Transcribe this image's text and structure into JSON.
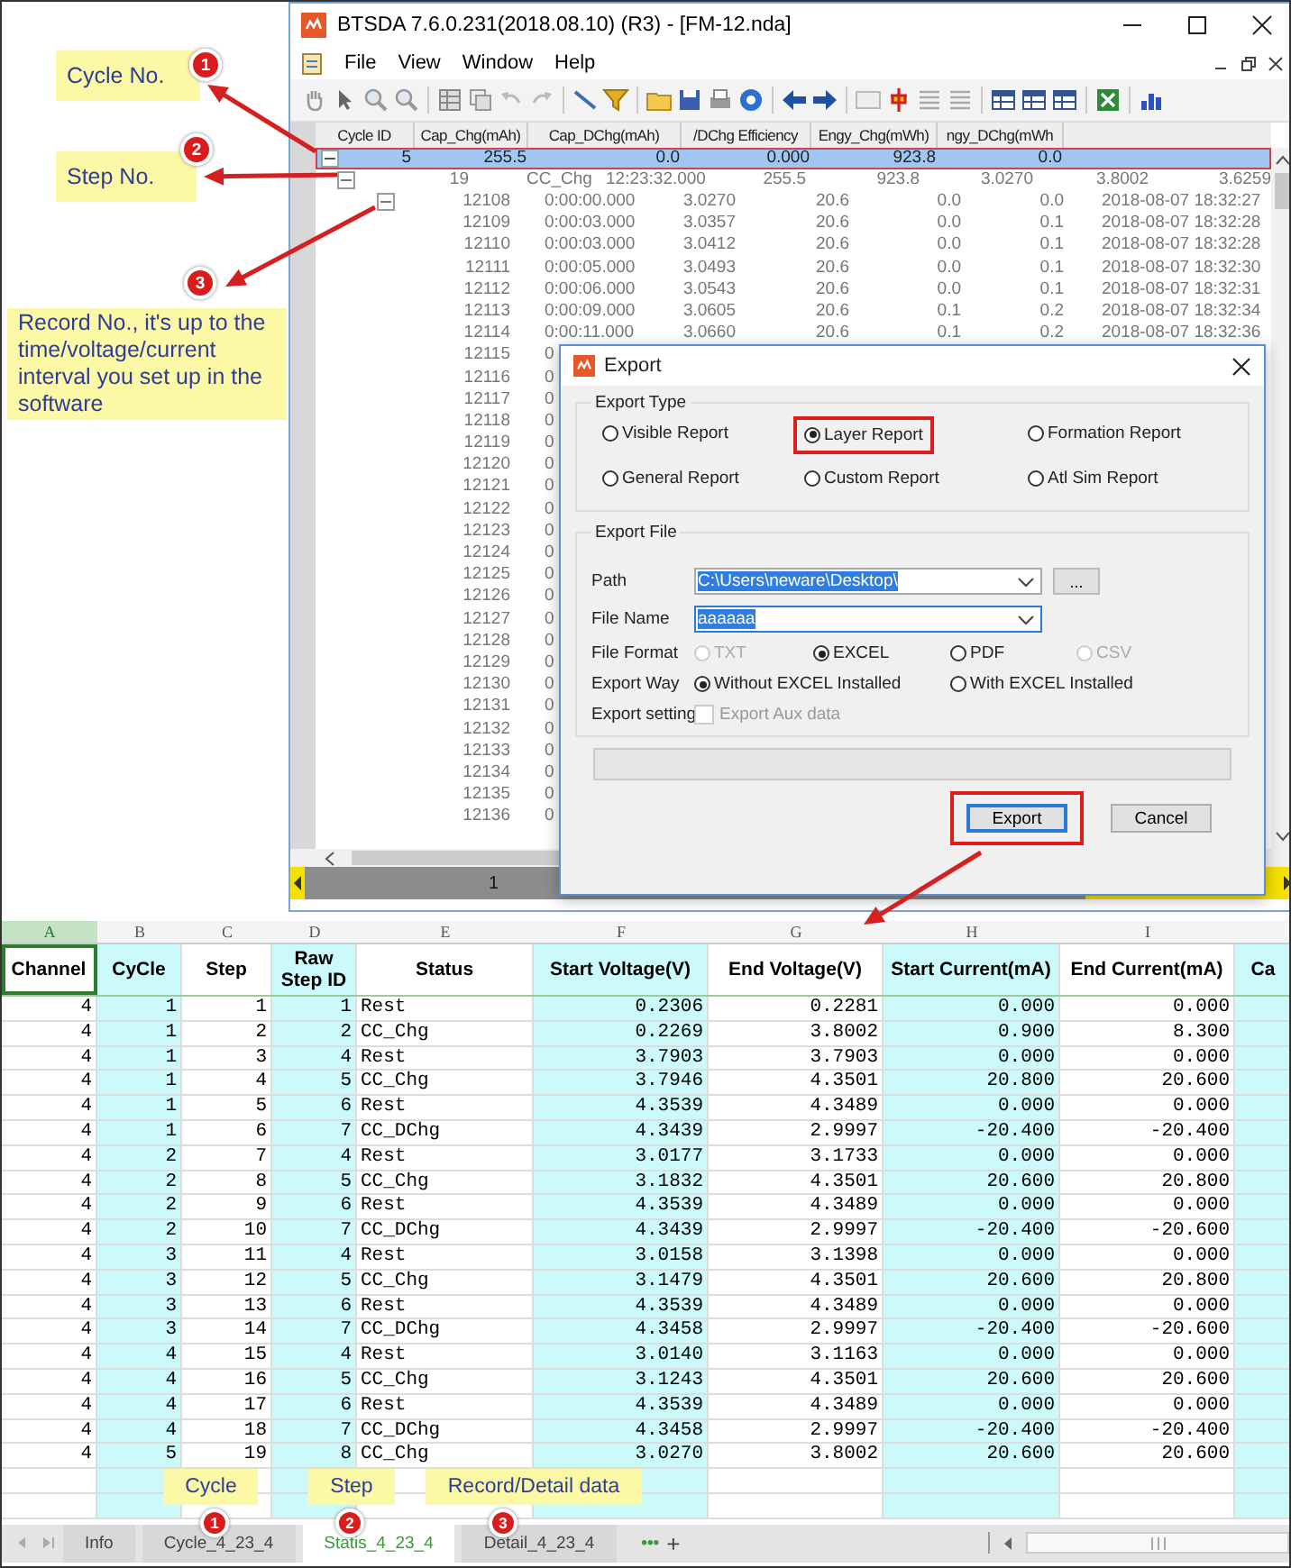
{
  "callouts": [
    {
      "text": "Cycle No.",
      "badge": "1"
    },
    {
      "text": "Step No.",
      "badge": "2"
    },
    {
      "text": "Record No., it's up to the time/voltage/current interval you set up in the software",
      "badge": "3"
    }
  ],
  "window": {
    "title": "BTSDA 7.6.0.231(2018.08.10) (R3) - [FM-12.nda]"
  },
  "menu": [
    "File",
    "View",
    "Window",
    "Help"
  ],
  "grid": {
    "columns": [
      "Cycle ID",
      "Cap_Chg(mAh)",
      "Cap_DChg(mAh)",
      "/DChg Efficiency",
      "Engy_Chg(mWh)",
      "ngy_DChg(mWh"
    ],
    "cycles": [
      {
        "values": [
          "5",
          "255.5",
          "0.0",
          "0.000",
          "923.8",
          "0.0"
        ],
        "selected": true,
        "highlighted": true,
        "expanded": true,
        "children": [
          {
            "values": [
              "19",
              "CC_Chg",
              "12:23:32.000",
              "255.5",
              "923.8",
              "3.0270",
              "3.8002",
              "3.6259"
            ],
            "expanded": true,
            "children": [
              {
                "expanded": true,
                "values": [
                  "12108",
                  "0:00:00.000",
                  "3.0270",
                  "20.6",
                  "0.0",
                  "0.0",
                  "2018-08-07 18:32:27"
                ]
              },
              {
                "values": [
                  "12109",
                  "0:00:03.000",
                  "3.0357",
                  "20.6",
                  "0.0",
                  "0.1",
                  "2018-08-07 18:32:28"
                ]
              },
              {
                "values": [
                  "12110",
                  "0:00:03.000",
                  "3.0412",
                  "20.6",
                  "0.0",
                  "0.1",
                  "2018-08-07 18:32:28"
                ]
              },
              {
                "values": [
                  "12111",
                  "0:00:05.000",
                  "3.0493",
                  "20.6",
                  "0.0",
                  "0.1",
                  "2018-08-07 18:32:30"
                ]
              },
              {
                "values": [
                  "12112",
                  "0:00:06.000",
                  "3.0543",
                  "20.6",
                  "0.0",
                  "0.1",
                  "2018-08-07 18:32:31"
                ]
              },
              {
                "values": [
                  "12113",
                  "0:00:09.000",
                  "3.0605",
                  "20.6",
                  "0.1",
                  "0.2",
                  "2018-08-07 18:32:34"
                ]
              },
              {
                "values": [
                  "12114",
                  "0:00:11.000",
                  "3.0660",
                  "20.6",
                  "0.1",
                  "0.2",
                  "2018-08-07 18:32:36"
                ]
              },
              {
                "values": [
                  "12115",
                  "0"
                ]
              },
              {
                "values": [
                  "12116",
                  "0"
                ]
              },
              {
                "values": [
                  "12117",
                  "0"
                ]
              },
              {
                "values": [
                  "12118",
                  "0"
                ]
              },
              {
                "values": [
                  "12119",
                  "0"
                ]
              },
              {
                "values": [
                  "12120",
                  "0"
                ]
              },
              {
                "values": [
                  "12121",
                  "0"
                ]
              },
              {
                "values": [
                  "12122",
                  "0"
                ]
              },
              {
                "values": [
                  "12123",
                  "0"
                ]
              },
              {
                "values": [
                  "12124",
                  "0"
                ]
              },
              {
                "values": [
                  "12125",
                  "0"
                ]
              },
              {
                "values": [
                  "12126",
                  "0"
                ]
              },
              {
                "values": [
                  "12127",
                  "0"
                ]
              },
              {
                "values": [
                  "12128",
                  "0"
                ]
              },
              {
                "values": [
                  "12129",
                  "0"
                ]
              },
              {
                "values": [
                  "12130",
                  "0"
                ]
              },
              {
                "values": [
                  "12131",
                  "0"
                ]
              },
              {
                "values": [
                  "12132",
                  "0"
                ]
              },
              {
                "values": [
                  "12133",
                  "0"
                ]
              },
              {
                "values": [
                  "12134",
                  "0"
                ]
              },
              {
                "values": [
                  "12135",
                  "0"
                ]
              },
              {
                "values": [
                  "12136",
                  "0"
                ]
              }
            ]
          }
        ]
      }
    ],
    "page_indicator": "1"
  },
  "export_dialog": {
    "title": "Export",
    "export_type": {
      "label": "Export Type",
      "options": [
        {
          "label": "Visible Report",
          "selected": false,
          "highlighted": false
        },
        {
          "label": "Layer Report",
          "selected": true,
          "highlighted": true
        },
        {
          "label": "Formation Report",
          "selected": false,
          "highlighted": false
        },
        {
          "label": "General Report",
          "selected": false,
          "highlighted": false
        },
        {
          "label": "Custom Report",
          "selected": false,
          "highlighted": false
        },
        {
          "label": "Atl Sim Report",
          "selected": false,
          "highlighted": false
        }
      ]
    },
    "export_file": {
      "label": "Export File",
      "path": {
        "label": "Path",
        "value": "C:\\Users\\neware\\Desktop\\",
        "text_selected": true,
        "browse": "..."
      },
      "file_name": {
        "label": "File Name",
        "value": "aaaaaa",
        "text_selected": true
      },
      "file_format": {
        "label": "File Format",
        "options": [
          {
            "label": "TXT",
            "selected": false,
            "disabled": true
          },
          {
            "label": "EXCEL",
            "selected": true,
            "disabled": false
          },
          {
            "label": "PDF",
            "selected": false,
            "disabled": false
          },
          {
            "label": "CSV",
            "selected": false,
            "disabled": true
          }
        ]
      },
      "export_way": {
        "label": "Export Way",
        "options": [
          {
            "label": "Without EXCEL Installed",
            "selected": true,
            "disabled": false
          },
          {
            "label": "With EXCEL Installed",
            "selected": false,
            "disabled": false
          }
        ]
      },
      "export_setting": {
        "label": "Export setting",
        "checkbox": {
          "label": "Export Aux data",
          "checked": false,
          "disabled": true
        }
      }
    },
    "progress": {
      "level": 0
    },
    "buttons": [
      {
        "label": "Export",
        "default": true,
        "highlighted": true
      },
      {
        "label": "Cancel",
        "default": false,
        "highlighted": false
      }
    ]
  },
  "sheet": {
    "columns": [
      {
        "letter": "A",
        "label": "Channel",
        "shaded": false,
        "selected": true
      },
      {
        "letter": "B",
        "label": "CyCle",
        "shaded": true,
        "selected": false
      },
      {
        "letter": "C",
        "label": "Step",
        "shaded": false,
        "selected": false
      },
      {
        "letter": "D",
        "label": "Raw Step ID",
        "shaded": true,
        "selected": false
      },
      {
        "letter": "E",
        "label": "Status",
        "shaded": false,
        "selected": false
      },
      {
        "letter": "F",
        "label": "Start Voltage(V)",
        "shaded": true,
        "selected": false
      },
      {
        "letter": "G",
        "label": "End Voltage(V)",
        "shaded": false,
        "selected": false
      },
      {
        "letter": "H",
        "label": "Start Current(mA)",
        "shaded": true,
        "selected": false
      },
      {
        "letter": "I",
        "label": "End Current(mA)",
        "shaded": false,
        "selected": false
      },
      {
        "label": "Ca",
        "shaded": true,
        "selected": false
      }
    ],
    "rows": [
      [
        "4",
        "1",
        "1",
        "1",
        "Rest",
        "0.2306",
        "0.2281",
        "0.000",
        "0.000"
      ],
      [
        "4",
        "1",
        "2",
        "2",
        "CC_Chg",
        "0.2269",
        "3.8002",
        "0.900",
        "8.300"
      ],
      [
        "4",
        "1",
        "3",
        "4",
        "Rest",
        "3.7903",
        "3.7903",
        "0.000",
        "0.000"
      ],
      [
        "4",
        "1",
        "4",
        "5",
        "CC_Chg",
        "3.7946",
        "4.3501",
        "20.800",
        "20.600"
      ],
      [
        "4",
        "1",
        "5",
        "6",
        "Rest",
        "4.3539",
        "4.3489",
        "0.000",
        "0.000"
      ],
      [
        "4",
        "1",
        "6",
        "7",
        "CC_DChg",
        "4.3439",
        "2.9997",
        "-20.400",
        "-20.400"
      ],
      [
        "4",
        "2",
        "7",
        "4",
        "Rest",
        "3.0177",
        "3.1733",
        "0.000",
        "0.000"
      ],
      [
        "4",
        "2",
        "8",
        "5",
        "CC_Chg",
        "3.1832",
        "4.3501",
        "20.600",
        "20.800"
      ],
      [
        "4",
        "2",
        "9",
        "6",
        "Rest",
        "4.3539",
        "4.3489",
        "0.000",
        "0.000"
      ],
      [
        "4",
        "2",
        "10",
        "7",
        "CC_DChg",
        "4.3439",
        "2.9997",
        "-20.400",
        "-20.600"
      ],
      [
        "4",
        "3",
        "11",
        "4",
        "Rest",
        "3.0158",
        "3.1398",
        "0.000",
        "0.000"
      ],
      [
        "4",
        "3",
        "12",
        "5",
        "CC_Chg",
        "3.1479",
        "4.3501",
        "20.600",
        "20.800"
      ],
      [
        "4",
        "3",
        "13",
        "6",
        "Rest",
        "4.3539",
        "4.3489",
        "0.000",
        "0.000"
      ],
      [
        "4",
        "3",
        "14",
        "7",
        "CC_DChg",
        "4.3458",
        "2.9997",
        "-20.400",
        "-20.600"
      ],
      [
        "4",
        "4",
        "15",
        "4",
        "Rest",
        "3.0140",
        "3.1163",
        "0.000",
        "0.000"
      ],
      [
        "4",
        "4",
        "16",
        "5",
        "CC_Chg",
        "3.1243",
        "4.3501",
        "20.600",
        "20.600"
      ],
      [
        "4",
        "4",
        "17",
        "6",
        "Rest",
        "4.3539",
        "4.3489",
        "0.000",
        "0.000"
      ],
      [
        "4",
        "4",
        "18",
        "7",
        "CC_DChg",
        "4.3458",
        "2.9997",
        "-20.400",
        "-20.400"
      ],
      [
        "4",
        "5",
        "19",
        "8",
        "CC_Chg",
        "3.0270",
        "3.8002",
        "20.600",
        "20.600"
      ]
    ],
    "tabs": [
      {
        "label": "Info",
        "selected": false
      },
      {
        "label": "Cycle_4_23_4",
        "selected": false
      },
      {
        "label": "Statis_4_23_4",
        "selected": true
      },
      {
        "label": "Detail_4_23_4",
        "selected": false
      }
    ],
    "more": "•••",
    "add": "+"
  },
  "sheet_callouts": [
    {
      "text": "Cycle",
      "badge": "1"
    },
    {
      "text": "Step",
      "badge": "2"
    },
    {
      "text": "Record/Detail data",
      "badge": "3"
    }
  ]
}
